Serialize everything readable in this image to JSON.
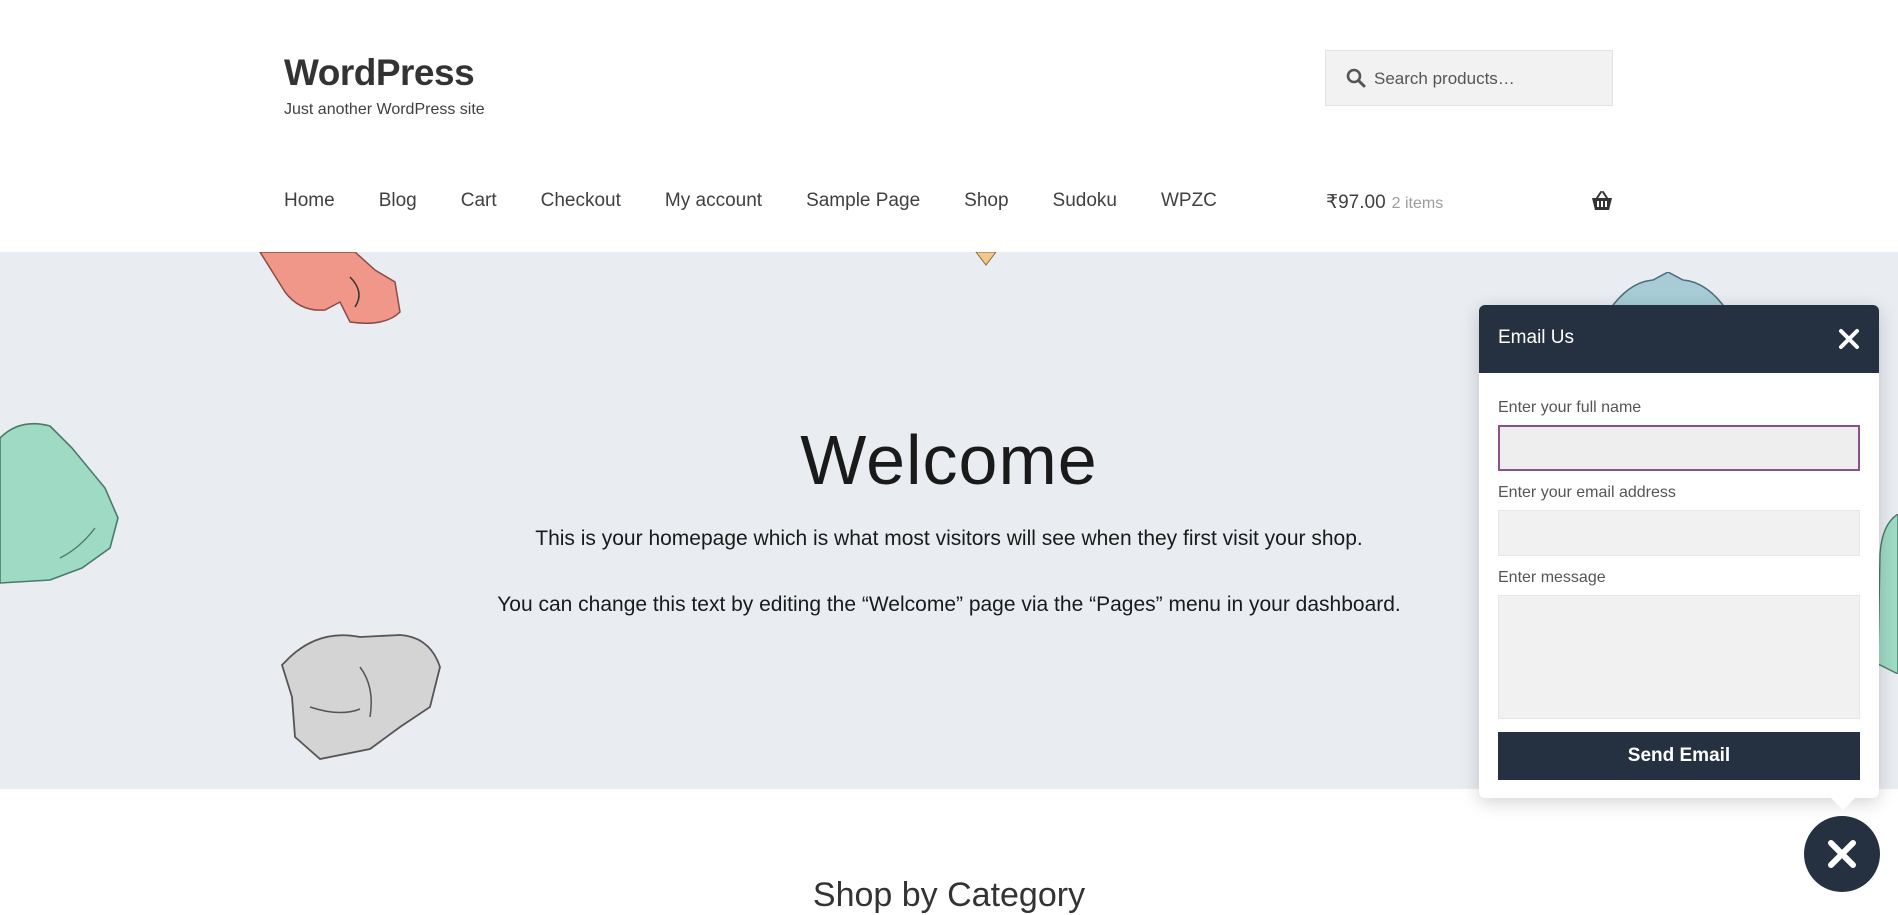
{
  "header": {
    "site_title": "WordPress",
    "tagline": "Just another WordPress site",
    "search": {
      "placeholder": "Search products…",
      "icon": "search-icon"
    }
  },
  "nav": {
    "items": [
      {
        "label": "Home"
      },
      {
        "label": "Blog"
      },
      {
        "label": "Cart"
      },
      {
        "label": "Checkout"
      },
      {
        "label": "My account"
      },
      {
        "label": "Sample Page"
      },
      {
        "label": "Shop"
      },
      {
        "label": "Sudoku"
      },
      {
        "label": "WPZC"
      }
    ]
  },
  "cart": {
    "total": "₹97.00",
    "count": "2 items",
    "icon": "basket-icon"
  },
  "hero": {
    "title": "Welcome",
    "paragraph_1": "This is your homepage which is what most visitors will see when they first visit your shop.",
    "paragraph_2": "You can change this text by editing the “Welcome” page via the “Pages” menu in your dashboard."
  },
  "section": {
    "title": "Shop by Category"
  },
  "email_popup": {
    "title": "Email Us",
    "name_label": "Enter your full name",
    "name_value": "",
    "email_label": "Enter your email address",
    "email_value": "",
    "message_label": "Enter message",
    "message_value": "",
    "send_label": "Send Email"
  },
  "colors": {
    "header_dark": "#253040",
    "hero_bg": "#e9edf1",
    "focus_border": "#8a4f8d",
    "field_bg": "#f1f1f1"
  }
}
